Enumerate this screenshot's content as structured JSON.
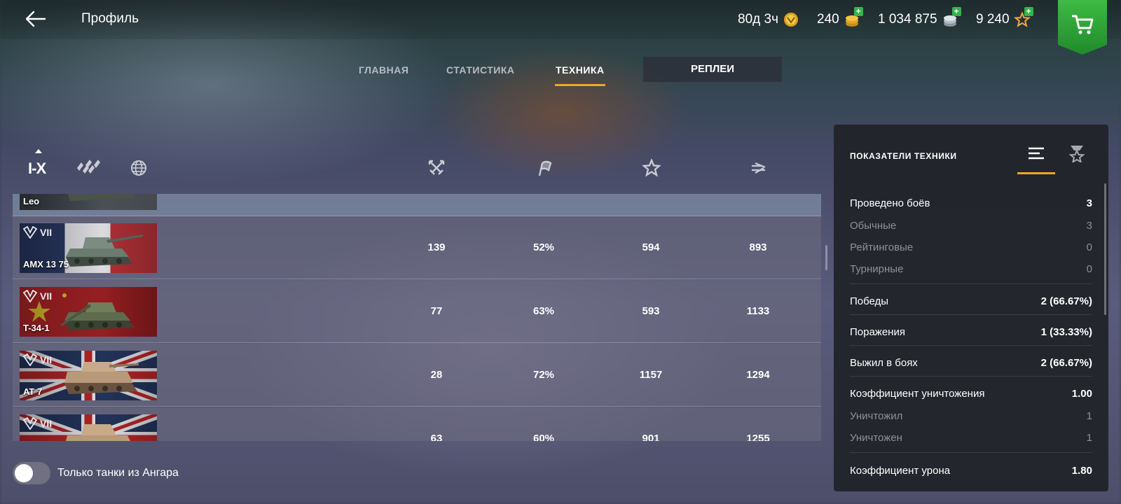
{
  "header": {
    "title": "Профиль",
    "premium": "80д 3ч",
    "gold": "240",
    "credits": "1 034 875",
    "free_xp": "9 240"
  },
  "tabs": [
    {
      "label": "ГЛАВНАЯ"
    },
    {
      "label": "СТАТИСТИКА"
    },
    {
      "label": "ТЕХНИКА"
    },
    {
      "label": "РЕПЛЕИ"
    }
  ],
  "filters": {
    "tier_label": "I-X"
  },
  "vehicles": [
    {
      "name": "Leo",
      "tier": "",
      "battles": "",
      "winrate": "",
      "xp": "",
      "damage": ""
    },
    {
      "name": "AMX 13 75",
      "tier": "VII",
      "battles": "139",
      "winrate": "52%",
      "xp": "594",
      "damage": "893"
    },
    {
      "name": "T-34-1",
      "tier": "VII",
      "battles": "77",
      "winrate": "63%",
      "xp": "593",
      "damage": "1133"
    },
    {
      "name": "AT 7",
      "tier": "VII",
      "battles": "28",
      "winrate": "72%",
      "xp": "1157",
      "damage": "1294"
    },
    {
      "name": "",
      "tier": "VII",
      "battles": "63",
      "winrate": "60%",
      "xp": "901",
      "damage": "1255"
    }
  ],
  "toggle": {
    "label": "Только танки из Ангара",
    "on": false
  },
  "panel": {
    "title": "ПОКАЗАТЕЛИ ТЕХНИКИ",
    "stats": [
      {
        "label": "Проведено боёв",
        "value": "3"
      },
      {
        "label": "Обычные",
        "value": "3"
      },
      {
        "label": "Рейтинговые",
        "value": "0"
      },
      {
        "label": "Турнирные",
        "value": "0"
      },
      {
        "label": "Победы",
        "value": "2 (66.67%)"
      },
      {
        "label": "Поражения",
        "value": "1 (33.33%)"
      },
      {
        "label": "Выжил в боях",
        "value": "2 (66.67%)"
      },
      {
        "label": "Коэффициент уничтожения",
        "value": "1.00"
      },
      {
        "label": "Уничтожил",
        "value": "1"
      },
      {
        "label": "Уничтожен",
        "value": "1"
      },
      {
        "label": "Коэффициент урона",
        "value": "1.80"
      }
    ]
  },
  "colors": {
    "accent": "#f5a623",
    "shop": "#2fa83a",
    "plus": "#37b24d"
  }
}
